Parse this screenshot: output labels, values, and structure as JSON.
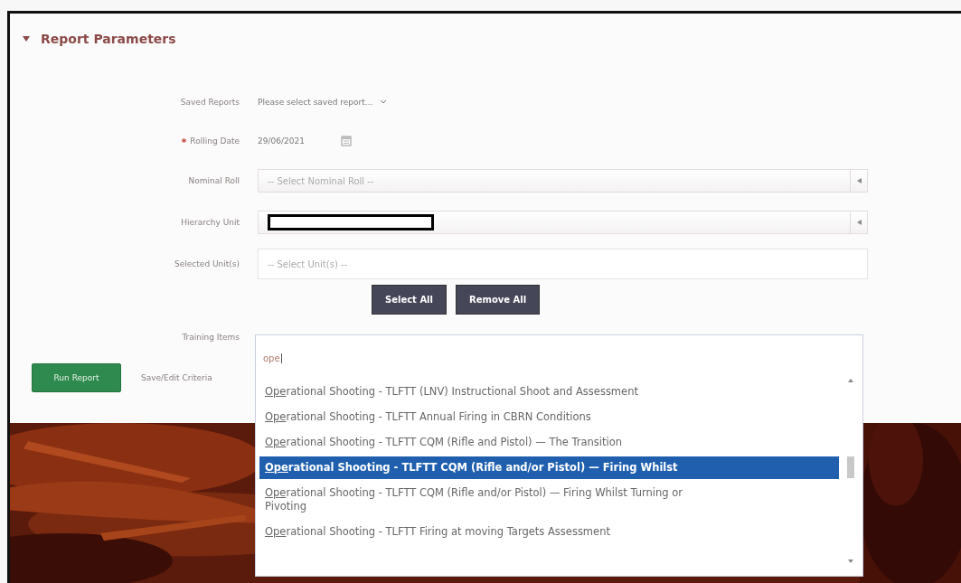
{
  "section": {
    "title": "Report Parameters",
    "expanded": true
  },
  "fields": [
    {
      "kind": "plain-select",
      "label": "Saved Reports",
      "value": "Please select saved report...",
      "required": false
    },
    {
      "kind": "date",
      "label": "Rolling Date",
      "value": "29/06/2021",
      "required": true
    },
    {
      "kind": "select",
      "label": "Nominal Roll",
      "placeholder": "-- Select Nominal Roll --",
      "required": false
    },
    {
      "kind": "redacted-select",
      "label": "Hierarchy Unit",
      "required": false
    },
    {
      "kind": "multi",
      "label": "Selected Unit(s)",
      "placeholder": "-- Select Unit(s) --",
      "required": false
    }
  ],
  "unit_buttons": [
    "Select All",
    "Remove All"
  ],
  "training": {
    "label": "Training Items",
    "query": "ope",
    "options": [
      {
        "text": "Operational Shooting - TLFTT (LNV) Instructional Shoot and Assessment",
        "selected": false
      },
      {
        "text": "Operational Shooting - TLFTT Annual Firing in CBRN Conditions",
        "selected": false
      },
      {
        "text": "Operational Shooting - TLFTT CQM (Rifle and Pistol) — The Transition",
        "selected": false
      },
      {
        "text": "Operational Shooting - TLFTT CQM (Rifle and/or Pistol) — Firing Whilst",
        "selected": true
      },
      {
        "text": "Operational Shooting - TLFTT CQM (Rifle and/or Pistol) — Firing Whilst Turning or Pivoting",
        "selected": false
      },
      {
        "text": "Operational Shooting - TLFTT Firing at moving Targets Assessment",
        "selected": false
      }
    ]
  },
  "actions": {
    "run": "Run Report",
    "save": "Save/Edit Criteria"
  }
}
